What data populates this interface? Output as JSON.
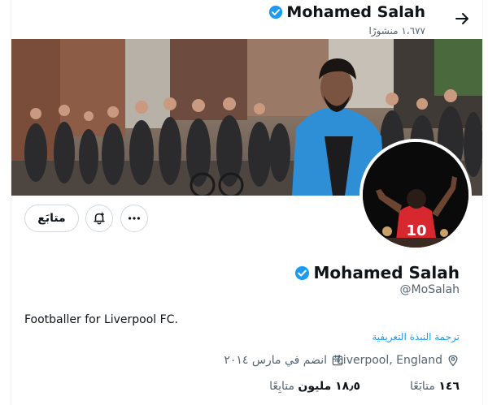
{
  "header": {
    "name": "Mohamed Salah",
    "posts": "١،٦٧٧ منشورًا"
  },
  "profile": {
    "name": "Mohamed Salah",
    "handle": "@MoSalah",
    "bio": "Footballer for Liverpool FC.",
    "translate": "ترجمة النبذة التعريفية",
    "location": "Liverpool, England",
    "joined": "انضم في مارس ٢٠١٤",
    "following_count": "١٤٦",
    "following_label": "متابَعًا",
    "followers_count": "١٨٫٥ مليون",
    "followers_label": "متابِعًا"
  },
  "actions": {
    "follow_label": "متابَع"
  },
  "icons": [
    "back-arrow-icon",
    "verified-badge-icon",
    "more-icon",
    "notification-bell-icon",
    "calendar-icon",
    "location-pin-icon"
  ],
  "colors": {
    "verified": "#1d9bf0",
    "link": "#1d9bf0",
    "muted": "#536471"
  }
}
